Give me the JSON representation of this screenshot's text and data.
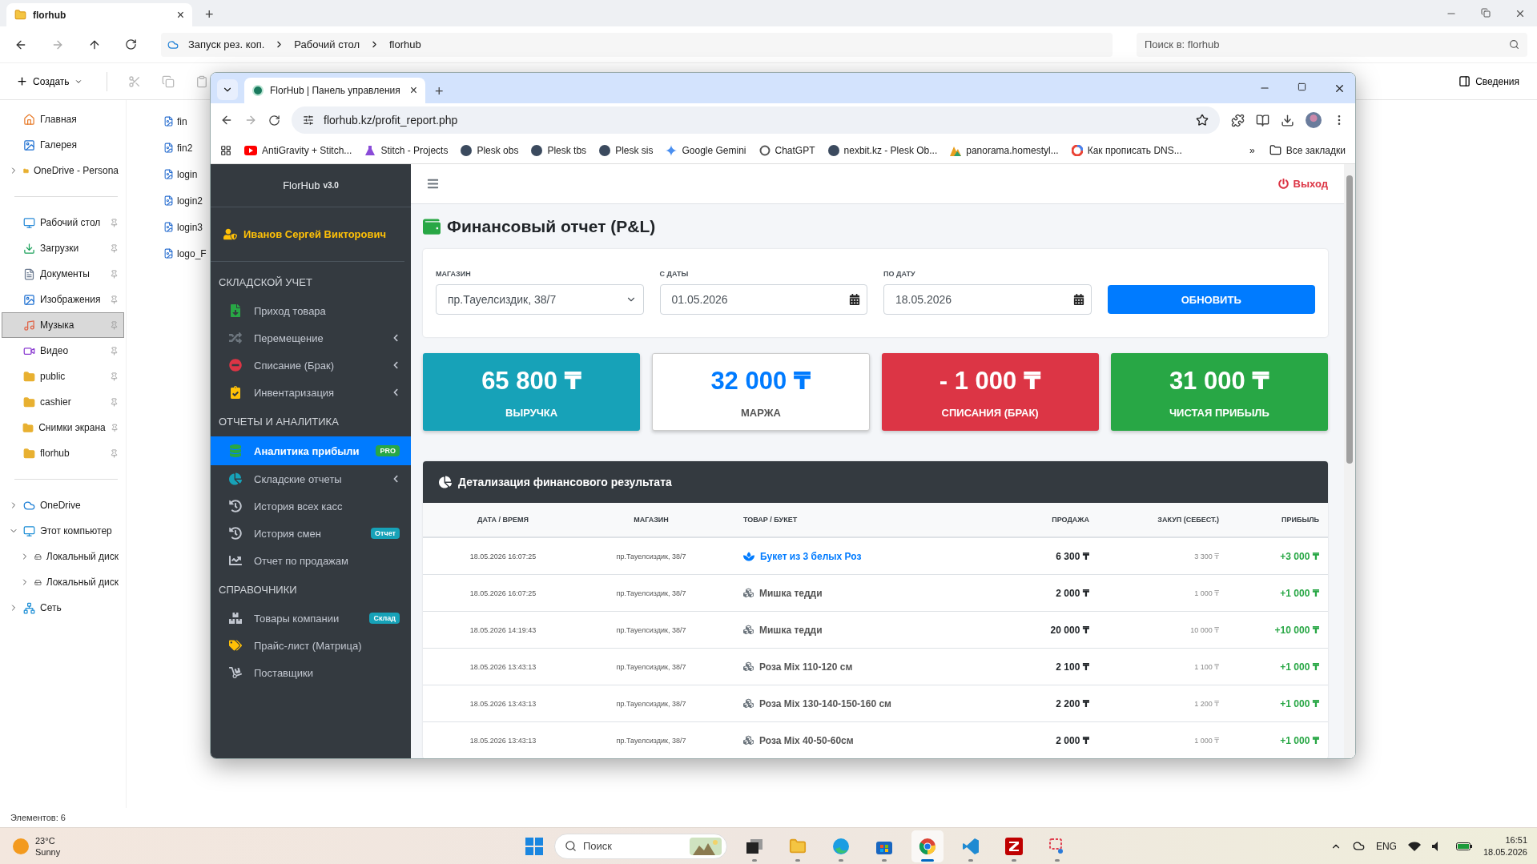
{
  "explorer": {
    "tab": {
      "title": "florhub",
      "close": "×",
      "add": "+"
    },
    "breadcrumbs": [
      "Запуск рез. коп.",
      "Рабочий стол",
      "florhub"
    ],
    "search": {
      "placeholder": "Поиск в: florhub"
    },
    "toolbar": {
      "create": "Создать",
      "details": "Сведения"
    },
    "nav": [
      [
        {
          "label": "Главная",
          "kind": "home",
          "selected": false
        },
        {
          "label": "Галерея",
          "kind": "gallery",
          "selected": false
        },
        {
          "label": "OneDrive - Persona",
          "kind": "cloudfolder",
          "expanded": false,
          "selected": false
        }
      ],
      [
        {
          "label": "Рабочий стол",
          "kind": "desktop",
          "pinned": true,
          "selected": false
        },
        {
          "label": "Загрузки",
          "kind": "download",
          "pinned": true,
          "selected": false
        },
        {
          "label": "Документы",
          "kind": "docs",
          "pinned": true,
          "selected": false
        },
        {
          "label": "Изображения",
          "kind": "images",
          "pinned": true,
          "selected": false
        },
        {
          "label": "Музыка",
          "kind": "music",
          "pinned": true,
          "selected": true
        },
        {
          "label": "Видео",
          "kind": "video",
          "pinned": true,
          "selected": false
        },
        {
          "label": "public",
          "kind": "folder",
          "pinned": true,
          "selected": false
        },
        {
          "label": "cashier",
          "kind": "folder",
          "pinned": true,
          "selected": false
        },
        {
          "label": "Снимки экрана",
          "kind": "folder",
          "pinned": true,
          "selected": false
        },
        {
          "label": "florhub",
          "kind": "folder",
          "pinned": true,
          "selected": false
        }
      ],
      [
        {
          "label": "OneDrive",
          "kind": "cloud",
          "expanded": false,
          "selected": false
        },
        {
          "label": "Этот компьютер",
          "kind": "pc",
          "expanded": true,
          "selected": false,
          "children": [
            {
              "label": "Локальный диск",
              "kind": "disk",
              "expanded": false,
              "selected": false
            },
            {
              "label": "Локальный диск",
              "kind": "disk",
              "expanded": false,
              "selected": false
            }
          ]
        },
        {
          "label": "Сеть",
          "kind": "network",
          "expanded": false,
          "selected": false
        }
      ]
    ],
    "files": [
      "fin",
      "fin2",
      "login",
      "login2",
      "login3",
      "logo_F"
    ],
    "status": "Элементов: 6"
  },
  "browser": {
    "tab": {
      "title": "FlorHub | Панель управления",
      "close": "×",
      "add": "+"
    },
    "url": "florhub.kz/profit_report.php",
    "bookmarks": [
      {
        "label": "AntiGravity + Stitch...",
        "kind": "youtube"
      },
      {
        "label": "Stitch - Projects",
        "kind": "flask"
      },
      {
        "label": "Plesk obs",
        "kind": "plesk"
      },
      {
        "label": "Plesk tbs",
        "kind": "plesk"
      },
      {
        "label": "Plesk sis",
        "kind": "plesk"
      },
      {
        "label": "Google Gemini",
        "kind": "sparkle"
      },
      {
        "label": "ChatGPT",
        "kind": "knot"
      },
      {
        "label": "nexbit.kz - Plesk Ob...",
        "kind": "plesk"
      },
      {
        "label": "panorama.homestyl...",
        "kind": "panorama"
      },
      {
        "label": "Как прописать DNS...",
        "kind": "google"
      }
    ],
    "more": "»",
    "all_bookmarks": "Все закладки"
  },
  "app": {
    "brand": "FlorHub",
    "version": "v3.0",
    "user": "Иванов Сергей Викторович",
    "menu": [
      {
        "title": "СКЛАДСКОЙ УЧЕТ",
        "items": [
          {
            "label": "Приход товара",
            "kind": "arrival",
            "submenu": false,
            "selected": false
          },
          {
            "label": "Перемещение",
            "kind": "shuffle",
            "submenu": true,
            "selected": false
          },
          {
            "label": "Списание (Брак)",
            "kind": "minus",
            "submenu": true,
            "selected": false
          },
          {
            "label": "Инвентаризация",
            "kind": "clipboard",
            "submenu": true,
            "selected": false
          }
        ]
      },
      {
        "title": "ОТЧЕТЫ И АНАЛИТИКА",
        "items": [
          {
            "label": "Аналитика прибыли",
            "kind": "coins",
            "submenu": false,
            "selected": true,
            "badge": {
              "text": "PRO",
              "color": "#28a745"
            }
          },
          {
            "label": "Складские отчеты",
            "kind": "pie",
            "submenu": true,
            "selected": false
          },
          {
            "label": "История всех касс",
            "kind": "history",
            "submenu": false,
            "selected": false
          },
          {
            "label": "История смен",
            "kind": "history",
            "submenu": false,
            "selected": false,
            "badge": {
              "text": "Отчет",
              "color": "#17a2b8"
            }
          },
          {
            "label": "Отчет по продажам",
            "kind": "chart",
            "submenu": false,
            "selected": false
          }
        ]
      },
      {
        "title": "СПРАВОЧНИКИ",
        "items": [
          {
            "label": "Товары компании",
            "kind": "boxes",
            "submenu": false,
            "selected": false,
            "badge": {
              "text": "Склад",
              "color": "#17a2b8"
            }
          },
          {
            "label": "Прайс-лист (Матрица)",
            "kind": "tags",
            "submenu": false,
            "selected": false
          },
          {
            "label": "Поставщики",
            "kind": "dolly",
            "submenu": false,
            "selected": false
          }
        ]
      }
    ],
    "logout": "Выход",
    "title": "Финансовый отчет (P&L)",
    "filters": [
      {
        "label": "МАГАЗИН",
        "kind": "select",
        "value": "пр.Тауелсиздик, 38/7"
      },
      {
        "label": "С ДАТЫ",
        "kind": "date",
        "value": "01.05.2026"
      },
      {
        "label": "ПО ДАТУ",
        "kind": "date",
        "value": "18.05.2026"
      }
    ],
    "refresh": "ОБНОВИТЬ",
    "stats": [
      {
        "value": "65 800 ₸",
        "label": "ВЫРУЧКА",
        "kind": "info"
      },
      {
        "value": "32 000 ₸",
        "label": "МАРЖА",
        "kind": "outline"
      },
      {
        "value": "- 1 000 ₸",
        "label": "СПИСАНИЯ (БРАК)",
        "kind": "danger"
      },
      {
        "value": "31 000 ₸",
        "label": "ЧИСТАЯ ПРИБЫЛЬ",
        "kind": "success"
      }
    ],
    "details": {
      "title": "Детализация финансового результата",
      "columns": [
        "ДАТА / ВРЕМЯ",
        "МАГАЗИН",
        "ТОВАР / БУКЕТ",
        "ПРОДАЖА",
        "ЗАКУП (СЕБЕСТ.)",
        "ПРИБЫЛЬ"
      ],
      "rows": [
        {
          "date": "18.05.2026 16:07:25",
          "shop": "пр.Тауелсиздик, 38/7",
          "kind": "bouquet",
          "product": "Букет из 3 белых Роз",
          "sale": "6 300 ₸",
          "cost": "3 300 ₸",
          "profit": "+3 000 ₸"
        },
        {
          "date": "18.05.2026 16:07:25",
          "shop": "пр.Тауелсиздик, 38/7",
          "kind": "item",
          "product": "Мишка тедди",
          "sale": "2 000 ₸",
          "cost": "1 000 ₸",
          "profit": "+1 000 ₸"
        },
        {
          "date": "18.05.2026 14:19:43",
          "shop": "пр.Тауелсиздик, 38/7",
          "kind": "item",
          "product": "Мишка тедди",
          "sale": "20 000 ₸",
          "cost": "10 000 ₸",
          "profit": "+10 000 ₸"
        },
        {
          "date": "18.05.2026 13:43:13",
          "shop": "пр.Тауелсиздик, 38/7",
          "kind": "item",
          "product": "Роза Mix 110-120 см",
          "sale": "2 100 ₸",
          "cost": "1 100 ₸",
          "profit": "+1 000 ₸"
        },
        {
          "date": "18.05.2026 13:43:13",
          "shop": "пр.Тауелсиздик, 38/7",
          "kind": "item",
          "product": "Роза Mix 130-140-150-160 см",
          "sale": "2 200 ₸",
          "cost": "1 200 ₸",
          "profit": "+1 000 ₸"
        },
        {
          "date": "18.05.2026 13:43:13",
          "shop": "пр.Тауелсиздик, 38/7",
          "kind": "item",
          "product": "Роза Mix 40-50-60см",
          "sale": "2 000 ₸",
          "cost": "1 000 ₸",
          "profit": "+1 000 ₸"
        }
      ]
    }
  },
  "taskbar": {
    "temperature": "23°C",
    "weather": "Sunny",
    "search": {
      "placeholder": "Поиск"
    },
    "apps": [
      {
        "kind": "taskview",
        "selected": false
      },
      {
        "kind": "folder",
        "selected": false
      },
      {
        "kind": "edge",
        "selected": false
      },
      {
        "kind": "store",
        "selected": false
      },
      {
        "kind": "chrome",
        "selected": true
      },
      {
        "kind": "vscode",
        "selected": false
      },
      {
        "kind": "filezilla",
        "selected": false
      },
      {
        "kind": "snip",
        "selected": false
      }
    ],
    "language": "ENG",
    "time": "16:51",
    "date": "18.05.2026"
  }
}
